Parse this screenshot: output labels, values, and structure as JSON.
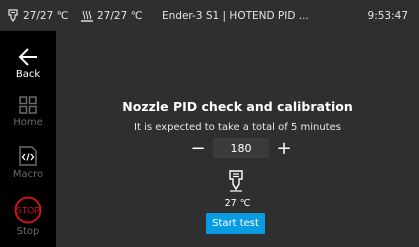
{
  "statusbar": {
    "nozzle_temp": "27/27 ℃",
    "bed_temp": "27/27 ℃",
    "title": "Ender-3 S1 | HOTEND PID ...",
    "time": "9:53:47"
  },
  "sidebar": {
    "items": [
      {
        "label": "Back",
        "icon": "back-arrow-icon"
      },
      {
        "label": "Home",
        "icon": "home-grid-icon"
      },
      {
        "label": "Macro",
        "icon": "macro-code-icon"
      },
      {
        "label": "Stop",
        "icon": "stop-icon"
      }
    ]
  },
  "main": {
    "title": "Nozzle PID check and calibration",
    "subtitle": "It is expected to take a total of 5 minutes",
    "stepper": {
      "minus": "−",
      "value": "180",
      "plus": "+"
    },
    "temperature": "27 ℃",
    "start_label": "Start test"
  },
  "colors": {
    "accent": "#0a9ce0",
    "stop": "#c4161c",
    "panel_bg": "#2f2f2f",
    "sidebar_bg": "#000000"
  }
}
